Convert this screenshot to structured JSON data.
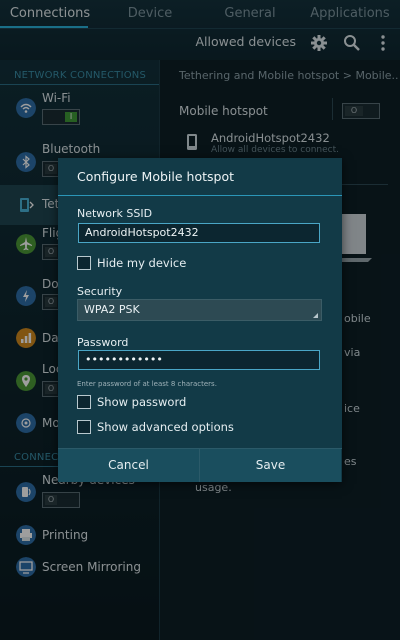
{
  "tabs": [
    {
      "label": "Connections",
      "active": true
    },
    {
      "label": "Device",
      "active": false
    },
    {
      "label": "General",
      "active": false
    },
    {
      "label": "Applications",
      "active": false
    }
  ],
  "toolbar": {
    "allowed_devices": "Allowed devices",
    "icons": [
      "gear-icon",
      "search-icon",
      "more-icon"
    ]
  },
  "sidebar": {
    "section1": "NETWORK CONNECTIONS",
    "section2": "CONNECT",
    "items": [
      {
        "label": "Wi-Fi",
        "icon": "wifi-icon",
        "toggle": "I"
      },
      {
        "label": "Bluetooth",
        "icon": "bluetooth-icon",
        "toggle": "O"
      },
      {
        "label": "Teth",
        "icon": "tethering-icon"
      },
      {
        "label": "Flig",
        "icon": "airplane-icon",
        "toggle": "O"
      },
      {
        "label": "Dov",
        "icon": "download-icon",
        "toggle": "O"
      },
      {
        "label": "Dat",
        "icon": "data-usage-icon"
      },
      {
        "label": "Loc",
        "icon": "location-icon",
        "toggle": "O"
      },
      {
        "label": "Mo",
        "icon": "more-networks-icon"
      },
      {
        "label": "Nearby devices",
        "icon": "nearby-devices-icon",
        "toggle": "O"
      },
      {
        "label": "Printing",
        "icon": "printer-icon"
      },
      {
        "label": "Screen Mirroring",
        "icon": "screen-mirroring-icon"
      }
    ]
  },
  "detail": {
    "breadcrumb": "Tethering and Mobile hotspot  >  Mobile..",
    "hotspot_label": "Mobile hotspot",
    "hotspot_toggle": "O",
    "network_name": "AndroidHotspot2432",
    "network_sub": "Allow all devices to connect.",
    "fragments": [
      "obile",
      "via",
      "ice",
      "es",
      "usage."
    ]
  },
  "dialog": {
    "title": "Configure Mobile hotspot",
    "ssid_label": "Network SSID",
    "ssid_value": "AndroidHotspot2432",
    "hide_label": "Hide my device",
    "security_label": "Security",
    "security_value": "WPA2 PSK",
    "password_label": "Password",
    "password_value": "••••••••••••",
    "password_hint": "Enter password of at least 8 characters.",
    "show_password": "Show password",
    "show_advanced": "Show advanced options",
    "cancel": "Cancel",
    "save": "Save"
  },
  "colors": {
    "accent": "#2bb3dc",
    "toggle_on": "#3f9a38",
    "dialog_bg": "#123a47"
  }
}
